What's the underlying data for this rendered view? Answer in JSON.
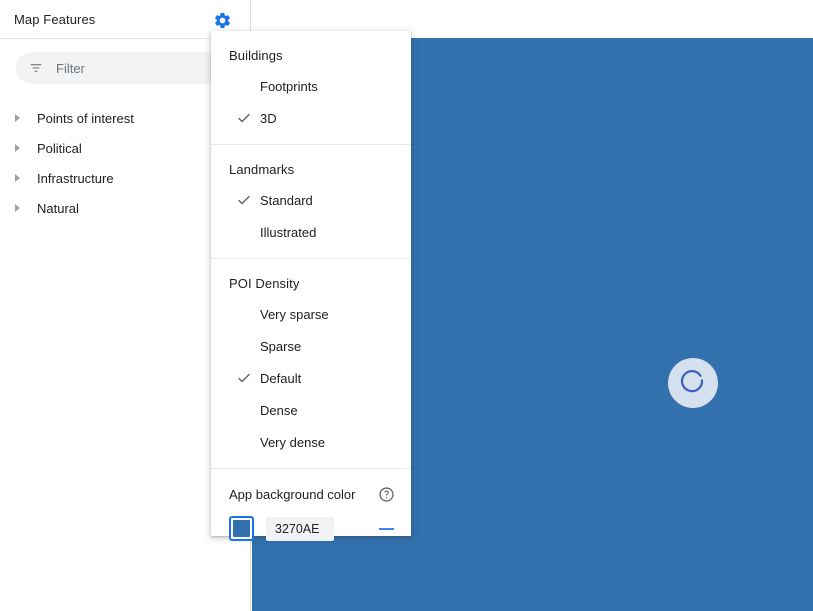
{
  "sidebar": {
    "title": "Map Features",
    "gear_icon": "gear-icon",
    "filter": {
      "icon": "filter-icon",
      "placeholder": "Filter",
      "value": ""
    },
    "tree_items": [
      {
        "label": "Points of interest",
        "expanded": false
      },
      {
        "label": "Political",
        "expanded": false
      },
      {
        "label": "Infrastructure",
        "expanded": false
      },
      {
        "label": "Natural",
        "expanded": false
      }
    ]
  },
  "menu": {
    "sections": [
      {
        "heading": "Buildings",
        "items": [
          {
            "label": "Footprints",
            "checked": false
          },
          {
            "label": "3D",
            "checked": true
          }
        ]
      },
      {
        "heading": "Landmarks",
        "items": [
          {
            "label": "Standard",
            "checked": true
          },
          {
            "label": "Illustrated",
            "checked": false
          }
        ]
      },
      {
        "heading": "POI Density",
        "items": [
          {
            "label": "Very sparse",
            "checked": false
          },
          {
            "label": "Sparse",
            "checked": false
          },
          {
            "label": "Default",
            "checked": true
          },
          {
            "label": "Dense",
            "checked": false
          },
          {
            "label": "Very dense",
            "checked": false
          }
        ]
      }
    ],
    "color_setting": {
      "label": "App background color",
      "help_icon": "help-circle-icon",
      "swatch_color": "#3270AE",
      "hex_value": "3270AE",
      "remove_icon": "minus-icon"
    }
  },
  "map": {
    "background_color": "#3270AE",
    "loading_spinner": "loading-spinner-icon"
  },
  "colors": {
    "accent": "#1a73e8",
    "map_blue": "#3270AE",
    "text": "#202124",
    "muted_text": "#70757a",
    "divider": "#e8eaed"
  }
}
